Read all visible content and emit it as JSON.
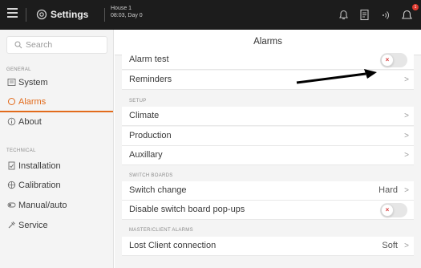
{
  "topbar": {
    "title": "Settings",
    "house_name": "House 1",
    "house_date": "08:03, Day 0",
    "notification_count": "1",
    "icons": [
      "menu-icon",
      "gear-icon",
      "alarm-bell-icon",
      "document-icon",
      "signal-icon",
      "notification-bell-icon"
    ]
  },
  "sidebar": {
    "search_placeholder": "Search",
    "general_label": "GENERAL",
    "technical_label": "TECHNICAL",
    "general_items": [
      {
        "label": "System",
        "icon": "system-icon"
      },
      {
        "label": "Alarms",
        "icon": "bell-icon",
        "active": true
      },
      {
        "label": "About",
        "icon": "info-icon"
      }
    ],
    "technical_items": [
      {
        "label": "Installation",
        "icon": "installation-icon"
      },
      {
        "label": "Calibration",
        "icon": "calibration-icon"
      },
      {
        "label": "Manual/auto",
        "icon": "manual-auto-icon"
      },
      {
        "label": "Service",
        "icon": "wrench-icon"
      }
    ]
  },
  "main": {
    "title": "Alarms",
    "rows": {
      "alarm_test": {
        "label": "Alarm test",
        "toggle": "off",
        "toggle_symbol": "×"
      },
      "reminders": {
        "label": "Reminders"
      },
      "climate": {
        "label": "Climate"
      },
      "production": {
        "label": "Production"
      },
      "auxillary": {
        "label": "Auxillary"
      },
      "switch_change": {
        "label": "Switch change",
        "value": "Hard"
      },
      "disable_popups": {
        "label": "Disable switch board pop-ups",
        "toggle": "off",
        "toggle_symbol": "×"
      },
      "lost_client": {
        "label": "Lost Client connection",
        "value": "Soft"
      }
    },
    "sections": {
      "setup": "SETUP",
      "switch_boards": "SWITCH BOARDS",
      "master_client": "MASTER/CLIENT ALARMS"
    }
  },
  "colors": {
    "accent": "#e26b1c",
    "topbar": "#1c1c1c",
    "toggle_off_mark": "#d63a3a",
    "badge": "#e03a2f"
  }
}
